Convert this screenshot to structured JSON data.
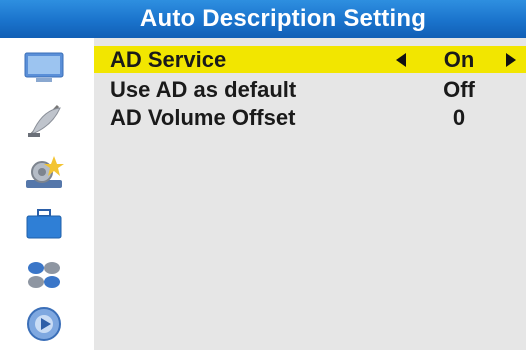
{
  "header": {
    "title": "Auto Description Setting"
  },
  "sidebar": {
    "icons": [
      "tv-icon",
      "satellite-dish-icon",
      "settings-gear-icon",
      "briefcase-icon",
      "circles-icon",
      "media-disc-icon"
    ]
  },
  "menu": {
    "items": [
      {
        "label": "AD Service",
        "value": "On",
        "selected": true
      },
      {
        "label": "Use AD as default",
        "value": "Off",
        "selected": false
      },
      {
        "label": "AD Volume Offset",
        "value": "0",
        "selected": false
      }
    ]
  },
  "colors": {
    "title_bar": "#1a73cc",
    "highlight": "#f2e600",
    "panel": "#e6e6e6"
  }
}
